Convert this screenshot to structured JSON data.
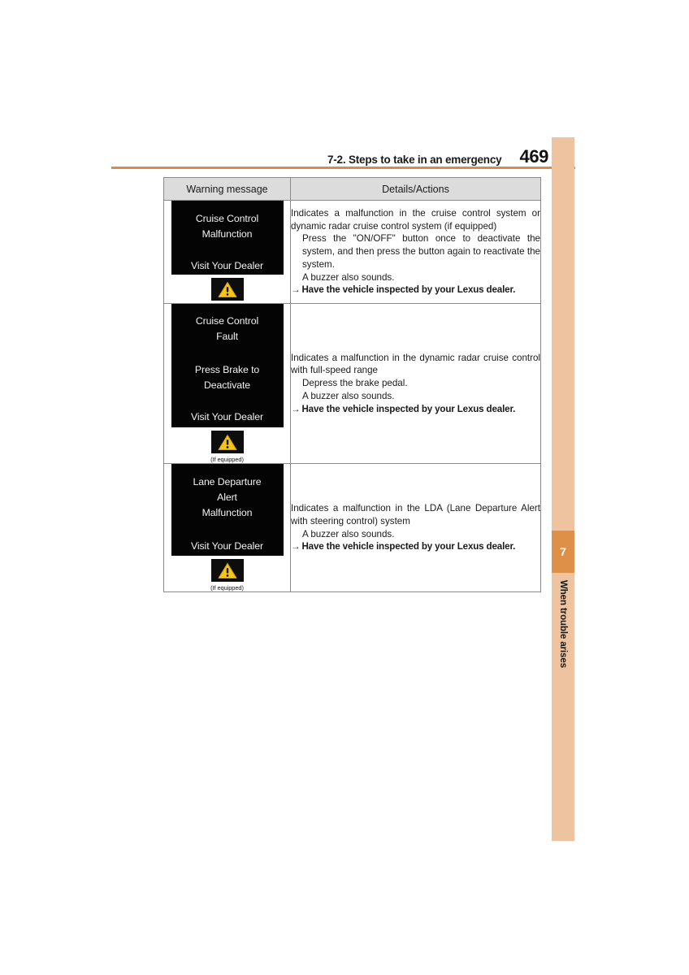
{
  "header": {
    "section": "7-2. Steps to take in an emergency",
    "page_number": "469",
    "rule_color": "#d98b4f"
  },
  "sidebar": {
    "chapter_number": "7",
    "chapter_label": "When trouble arises",
    "band_color": "#eec3a0",
    "badge_color": "#df9048"
  },
  "table": {
    "headers": {
      "warning_message": "Warning message",
      "details_actions": "Details/Actions"
    },
    "rows": [
      {
        "display": {
          "lines_top": [
            "Cruise Control",
            "Malfunction"
          ],
          "lines_bottom": [
            "Visit Your Dealer"
          ]
        },
        "icon": "warning-triangle-icon",
        "if_equipped_note": "",
        "details": {
          "lead": "Indicates a malfunction in the cruise control system or dynamic radar cruise control system (if equipped)",
          "indented": [
            "Press the \"ON/OFF\" button once to deactivate the system, and then press the button again to reactivate the system.",
            "A buzzer also sounds."
          ],
          "action_arrow": "→",
          "action": "Have the vehicle inspected by your Lexus dealer."
        }
      },
      {
        "display": {
          "lines_top": [
            "Cruise Control",
            "Fault"
          ],
          "lines_mid": [
            "Press Brake to",
            "Deactivate"
          ],
          "lines_bottom": [
            "Visit Your Dealer"
          ]
        },
        "icon": "warning-triangle-icon",
        "if_equipped_note": "(If equipped)",
        "details": {
          "lead": "Indicates a malfunction in the dynamic radar cruise control with full-speed range",
          "indented": [
            "Depress the brake pedal.",
            "A buzzer also sounds."
          ],
          "action_arrow": "→",
          "action": "Have the vehicle inspected by your Lexus dealer."
        }
      },
      {
        "display": {
          "lines_top": [
            "Lane Departure",
            "Alert",
            "Malfunction"
          ],
          "lines_bottom": [
            "Visit Your Dealer"
          ]
        },
        "icon": "warning-triangle-icon",
        "if_equipped_note": "(If equipped)",
        "details": {
          "lead": "Indicates a malfunction in the LDA (Lane Departure Alert with steering control) system",
          "indented": [
            "A buzzer also sounds."
          ],
          "action_arrow": "→",
          "action": "Have the vehicle inspected by your Lexus dealer."
        }
      }
    ]
  },
  "colors": {
    "display_background": "#040404",
    "display_text": "#f2f2f2",
    "warning_triangle": "#f5c518",
    "table_border": "#8a8a8a",
    "header_fill": "#dcdcdc"
  }
}
